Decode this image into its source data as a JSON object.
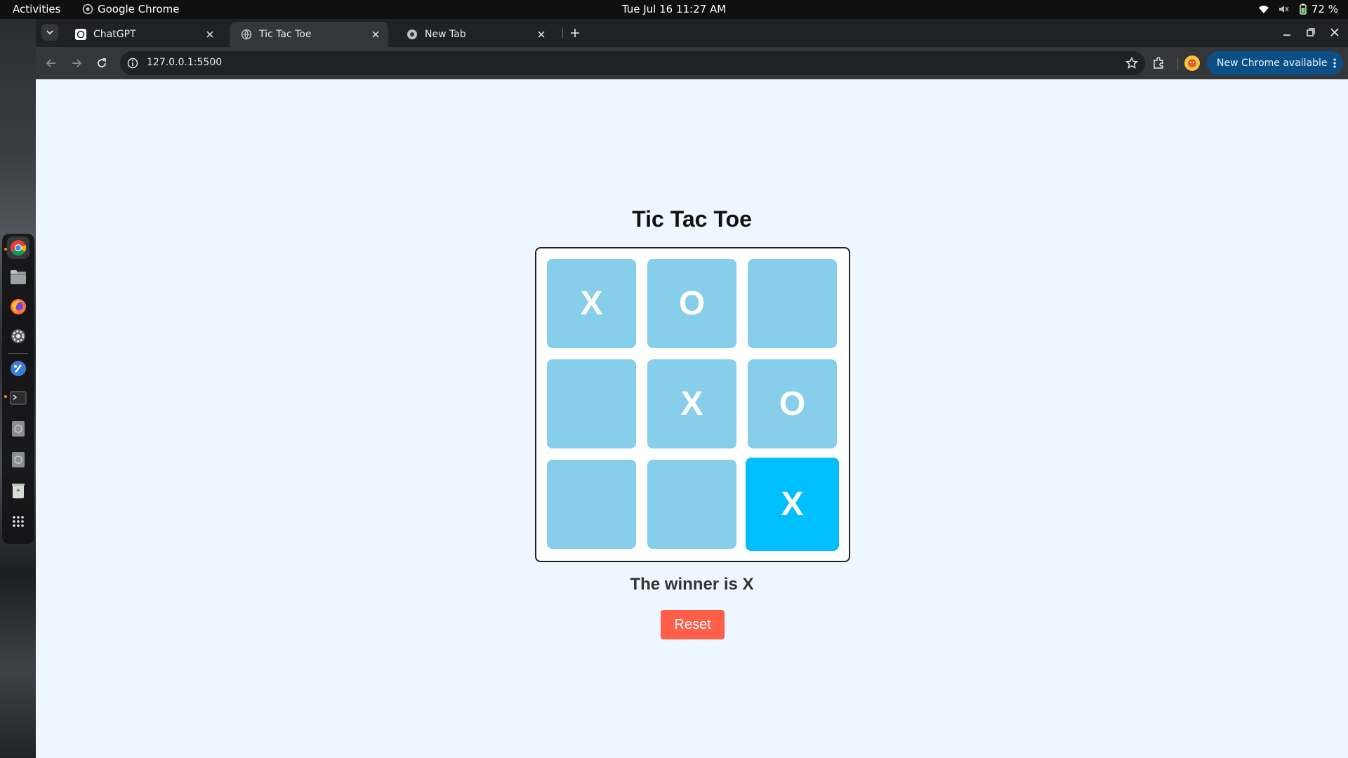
{
  "topbar": {
    "activities": "Activities",
    "app_name": "Google Chrome",
    "clock": "Tue Jul 16  11:27 AM",
    "battery": "72 %"
  },
  "dock": {
    "items": [
      "Google Chrome",
      "Files",
      "Firefox",
      "Settings",
      "Krita",
      "Terminal",
      "Disk",
      "Disk",
      "Trash",
      "Show Apps"
    ]
  },
  "browser": {
    "tabs": [
      {
        "title": "ChatGPT",
        "active": false
      },
      {
        "title": "Tic Tac Toe",
        "active": true
      },
      {
        "title": "New Tab",
        "active": false
      }
    ],
    "url": "127.0.0.1:5500",
    "update_label": "New Chrome available"
  },
  "game": {
    "title": "Tic Tac Toe",
    "board": [
      "X",
      "O",
      "",
      "",
      "X",
      "O",
      "",
      "",
      "X"
    ],
    "highlighted_cell": 8,
    "status": "The winner is X",
    "reset_label": "Reset"
  },
  "colors": {
    "cell": "#87ceeb",
    "cell_highlight": "#00bfff",
    "reset": "#ff5e48",
    "page_bg": "#eef6ff",
    "update_button": "#0b4f86"
  }
}
